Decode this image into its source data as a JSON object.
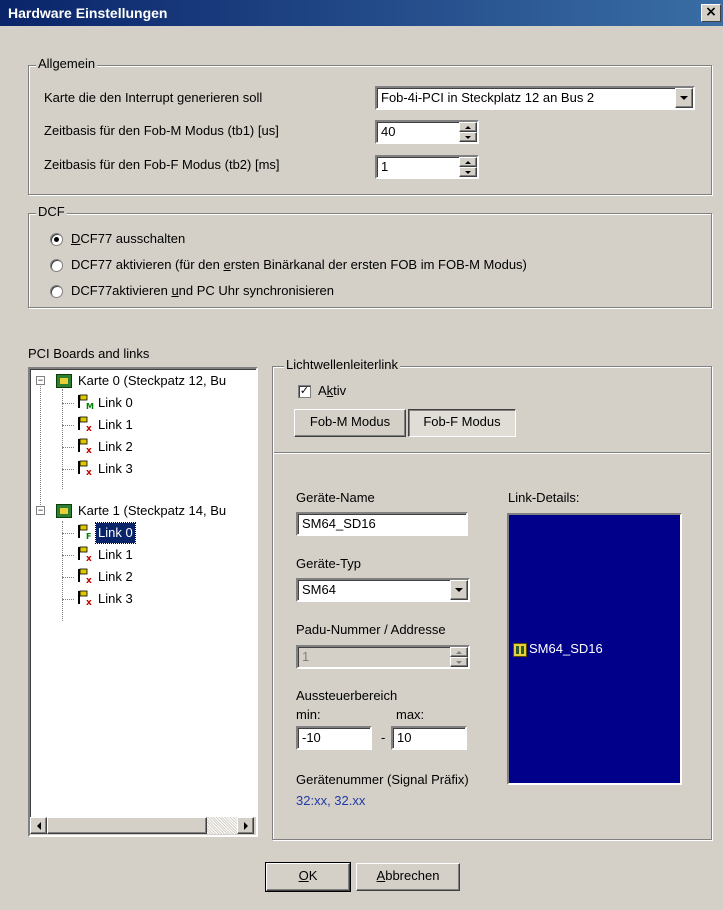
{
  "window": {
    "title": "Hardware Einstellungen",
    "close_glyph": "×"
  },
  "allgemein": {
    "legend": "Allgemein",
    "interrupt_label": "Karte die den Interrupt generieren soll",
    "interrupt_value": "Fob-4i-PCI in Steckplatz 12 an Bus 2",
    "tb1_label": "Zeitbasis für den Fob-M Modus (tb1) [us]",
    "tb1_value": "40",
    "tb2_label": "Zeitbasis für den Fob-F Modus (tb2) [ms]",
    "tb2_value": "1"
  },
  "dcf": {
    "legend": "DCF",
    "options": [
      {
        "pre": "",
        "u": "D",
        "post": "CF77 ausschalten",
        "selected": true
      },
      {
        "pre": "DCF77 aktivieren (für den ",
        "u": "e",
        "post": "rsten Binärkanal der ersten FOB im FOB-M Modus)",
        "selected": false
      },
      {
        "pre": "DCF77aktivieren ",
        "u": "u",
        "post": "nd PC Uhr synchronisieren",
        "selected": false
      }
    ]
  },
  "tree": {
    "label": "PCI Boards and links",
    "boards": [
      {
        "label": "Karte 0 (Steckpatz 12, Bu",
        "links": [
          {
            "label": "Link 0",
            "badge": "M",
            "badge_color": "#008000"
          },
          {
            "label": "Link 1",
            "badge": "x",
            "badge_color": "#c00000"
          },
          {
            "label": "Link 2",
            "badge": "x",
            "badge_color": "#c00000"
          },
          {
            "label": "Link 3",
            "badge": "x",
            "badge_color": "#c00000"
          }
        ]
      },
      {
        "label": "Karte 1 (Steckpatz 14, Bu",
        "links": [
          {
            "label": "Link 0",
            "badge": "F",
            "badge_color": "#008000",
            "selected": true
          },
          {
            "label": "Link 1",
            "badge": "x",
            "badge_color": "#c00000"
          },
          {
            "label": "Link 2",
            "badge": "x",
            "badge_color": "#c00000"
          },
          {
            "label": "Link 3",
            "badge": "x",
            "badge_color": "#c00000"
          }
        ]
      }
    ]
  },
  "link": {
    "legend": "Lichtwellenleiterlink",
    "aktiv_pre": "A",
    "aktiv_u": "k",
    "aktiv_post": "tiv",
    "aktiv_checked": "✓",
    "fob_m_label": "Fob-M Modus",
    "fob_f_label": "Fob-F Modus",
    "geraete_name_label": "Geräte-Name",
    "geraete_name_value": "SM64_SD16",
    "geraete_typ_label": "Geräte-Typ",
    "geraete_typ_value": "SM64",
    "padu_label": "Padu-Nummer / Addresse",
    "padu_value": "1",
    "aussteuer_label": "Aussteuerbereich",
    "min_label": "min:",
    "max_label": "max:",
    "min_value": "-10",
    "max_value": "10",
    "dash": "-",
    "geraetenummer_label": "Gerätenummer (Signal Präfix)",
    "geraetenummer_value": "32:xx, 32.xx",
    "details_label": "Link-Details:",
    "details_item": "SM64_SD16"
  },
  "buttons": {
    "ok_u": "O",
    "ok_post": "K",
    "cancel_u": "A",
    "cancel_post": "bbrechen"
  },
  "colors": {
    "title_start": "#0a246a",
    "title_end": "#3a6ea5",
    "details_bg": "#00008b",
    "geraetenummer_value": "#1f3aa8"
  },
  "icons": {
    "board": "pci-board-icon",
    "link": "link-flag-icon",
    "device": "device-icon"
  }
}
